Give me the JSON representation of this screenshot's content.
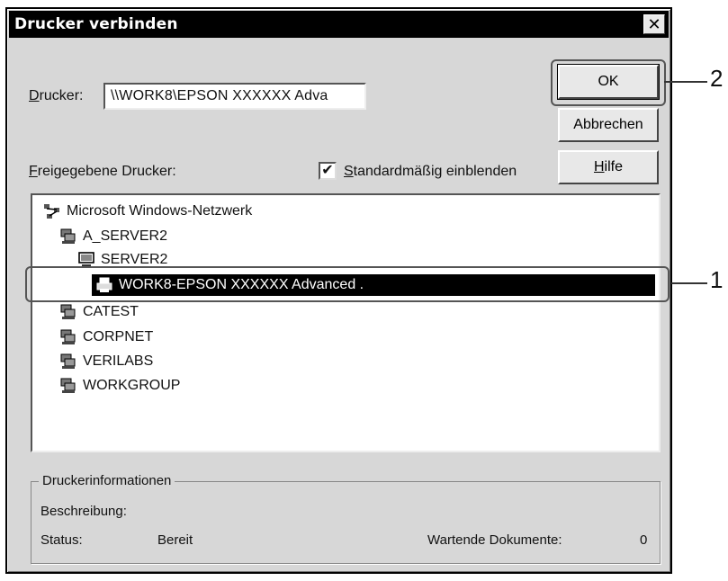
{
  "dialog": {
    "title": "Drucker verbinden",
    "close_glyph": "✕"
  },
  "printer_field": {
    "label_underlined": "D",
    "label_rest": "rucker:",
    "value": "\\\\WORK8\\EPSON XXXXXX Adva"
  },
  "buttons": {
    "ok": "OK",
    "cancel": "Abbrechen",
    "help_underlined": "H",
    "help_rest": "ilfe"
  },
  "shared_printers": {
    "label_underlined": "F",
    "label_rest": "reigegebene Drucker:",
    "checkbox_checked": true,
    "checkbox_mark": "✔",
    "checkbox_label_underlined": "S",
    "checkbox_label_rest": "tandardmäßig einblenden"
  },
  "tree": [
    {
      "label": "Microsoft Windows-Netzwerk",
      "icon": "network-icon",
      "level": 0,
      "selected": false
    },
    {
      "label": "A_SERVER2",
      "icon": "workgroup-icon",
      "level": 1,
      "selected": false
    },
    {
      "label": "SERVER2",
      "icon": "computer-icon",
      "level": 2,
      "selected": false
    },
    {
      "label": "WORK8-EPSON XXXXXX Advanced .",
      "icon": "printer-icon",
      "level": 3,
      "selected": true
    },
    {
      "label": "CATEST",
      "icon": "workgroup-icon",
      "level": 1,
      "selected": false
    },
    {
      "label": "CORPNET",
      "icon": "workgroup-icon",
      "level": 1,
      "selected": false
    },
    {
      "label": "VERILABS",
      "icon": "workgroup-icon",
      "level": 1,
      "selected": false
    },
    {
      "label": "WORKGROUP",
      "icon": "workgroup-icon",
      "level": 1,
      "selected": false
    }
  ],
  "printer_info": {
    "group_title": "Druckerinformationen",
    "description_label": "Beschreibung:",
    "description_value": "",
    "status_label": "Status:",
    "status_value": "Bereit",
    "waiting_label": "Wartende Dokumente:",
    "waiting_value": "0"
  },
  "callouts": {
    "one": "1",
    "two": "2"
  }
}
